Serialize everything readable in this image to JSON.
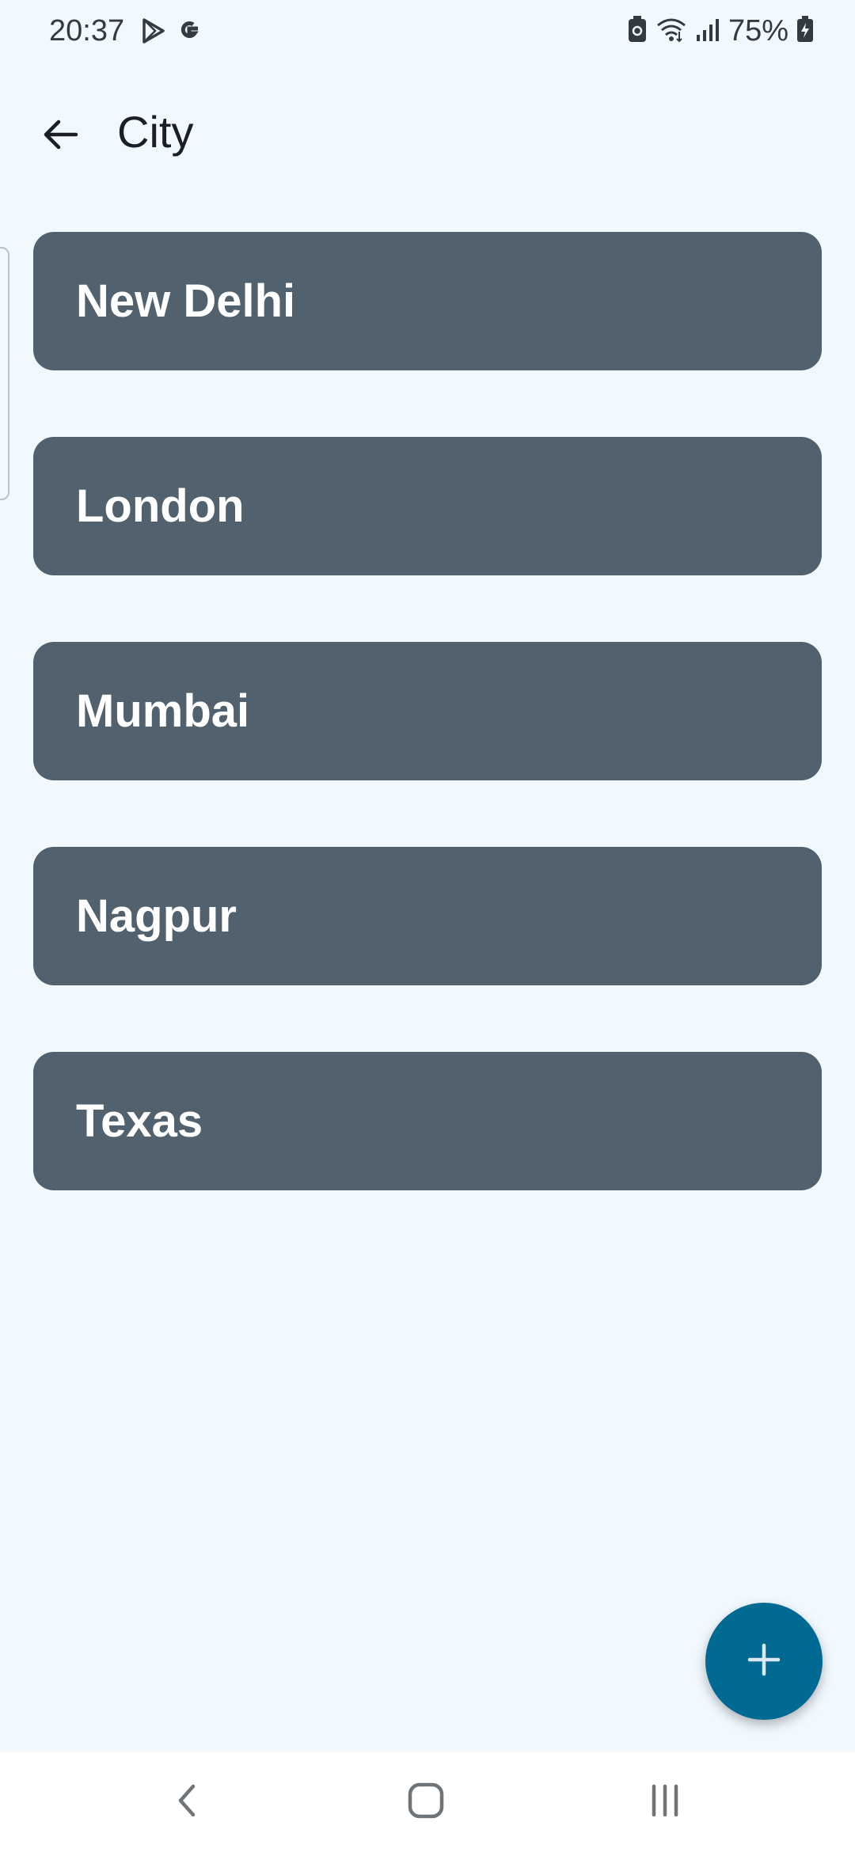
{
  "status_bar": {
    "time": "20:37",
    "battery_percent": "75%",
    "left_icons": [
      "play-store-icon",
      "google-icon"
    ],
    "right_icons": [
      "battery-saver-icon",
      "wifi-icon",
      "signal-icon",
      "battery-charging-icon"
    ]
  },
  "app_bar": {
    "title": "City",
    "back_icon": "arrow-back-icon"
  },
  "cities": [
    {
      "name": "New Delhi"
    },
    {
      "name": "London"
    },
    {
      "name": "Mumbai"
    },
    {
      "name": "Nagpur"
    },
    {
      "name": "Texas"
    }
  ],
  "fab": {
    "icon": "plus-icon"
  },
  "nav_bar": {
    "icons": [
      "nav-back-icon",
      "nav-home-icon",
      "nav-recents-icon"
    ]
  },
  "colors": {
    "background": "#f1f8fe",
    "card": "#51626e",
    "card_text": "#ffffff",
    "fab": "#006a93"
  }
}
